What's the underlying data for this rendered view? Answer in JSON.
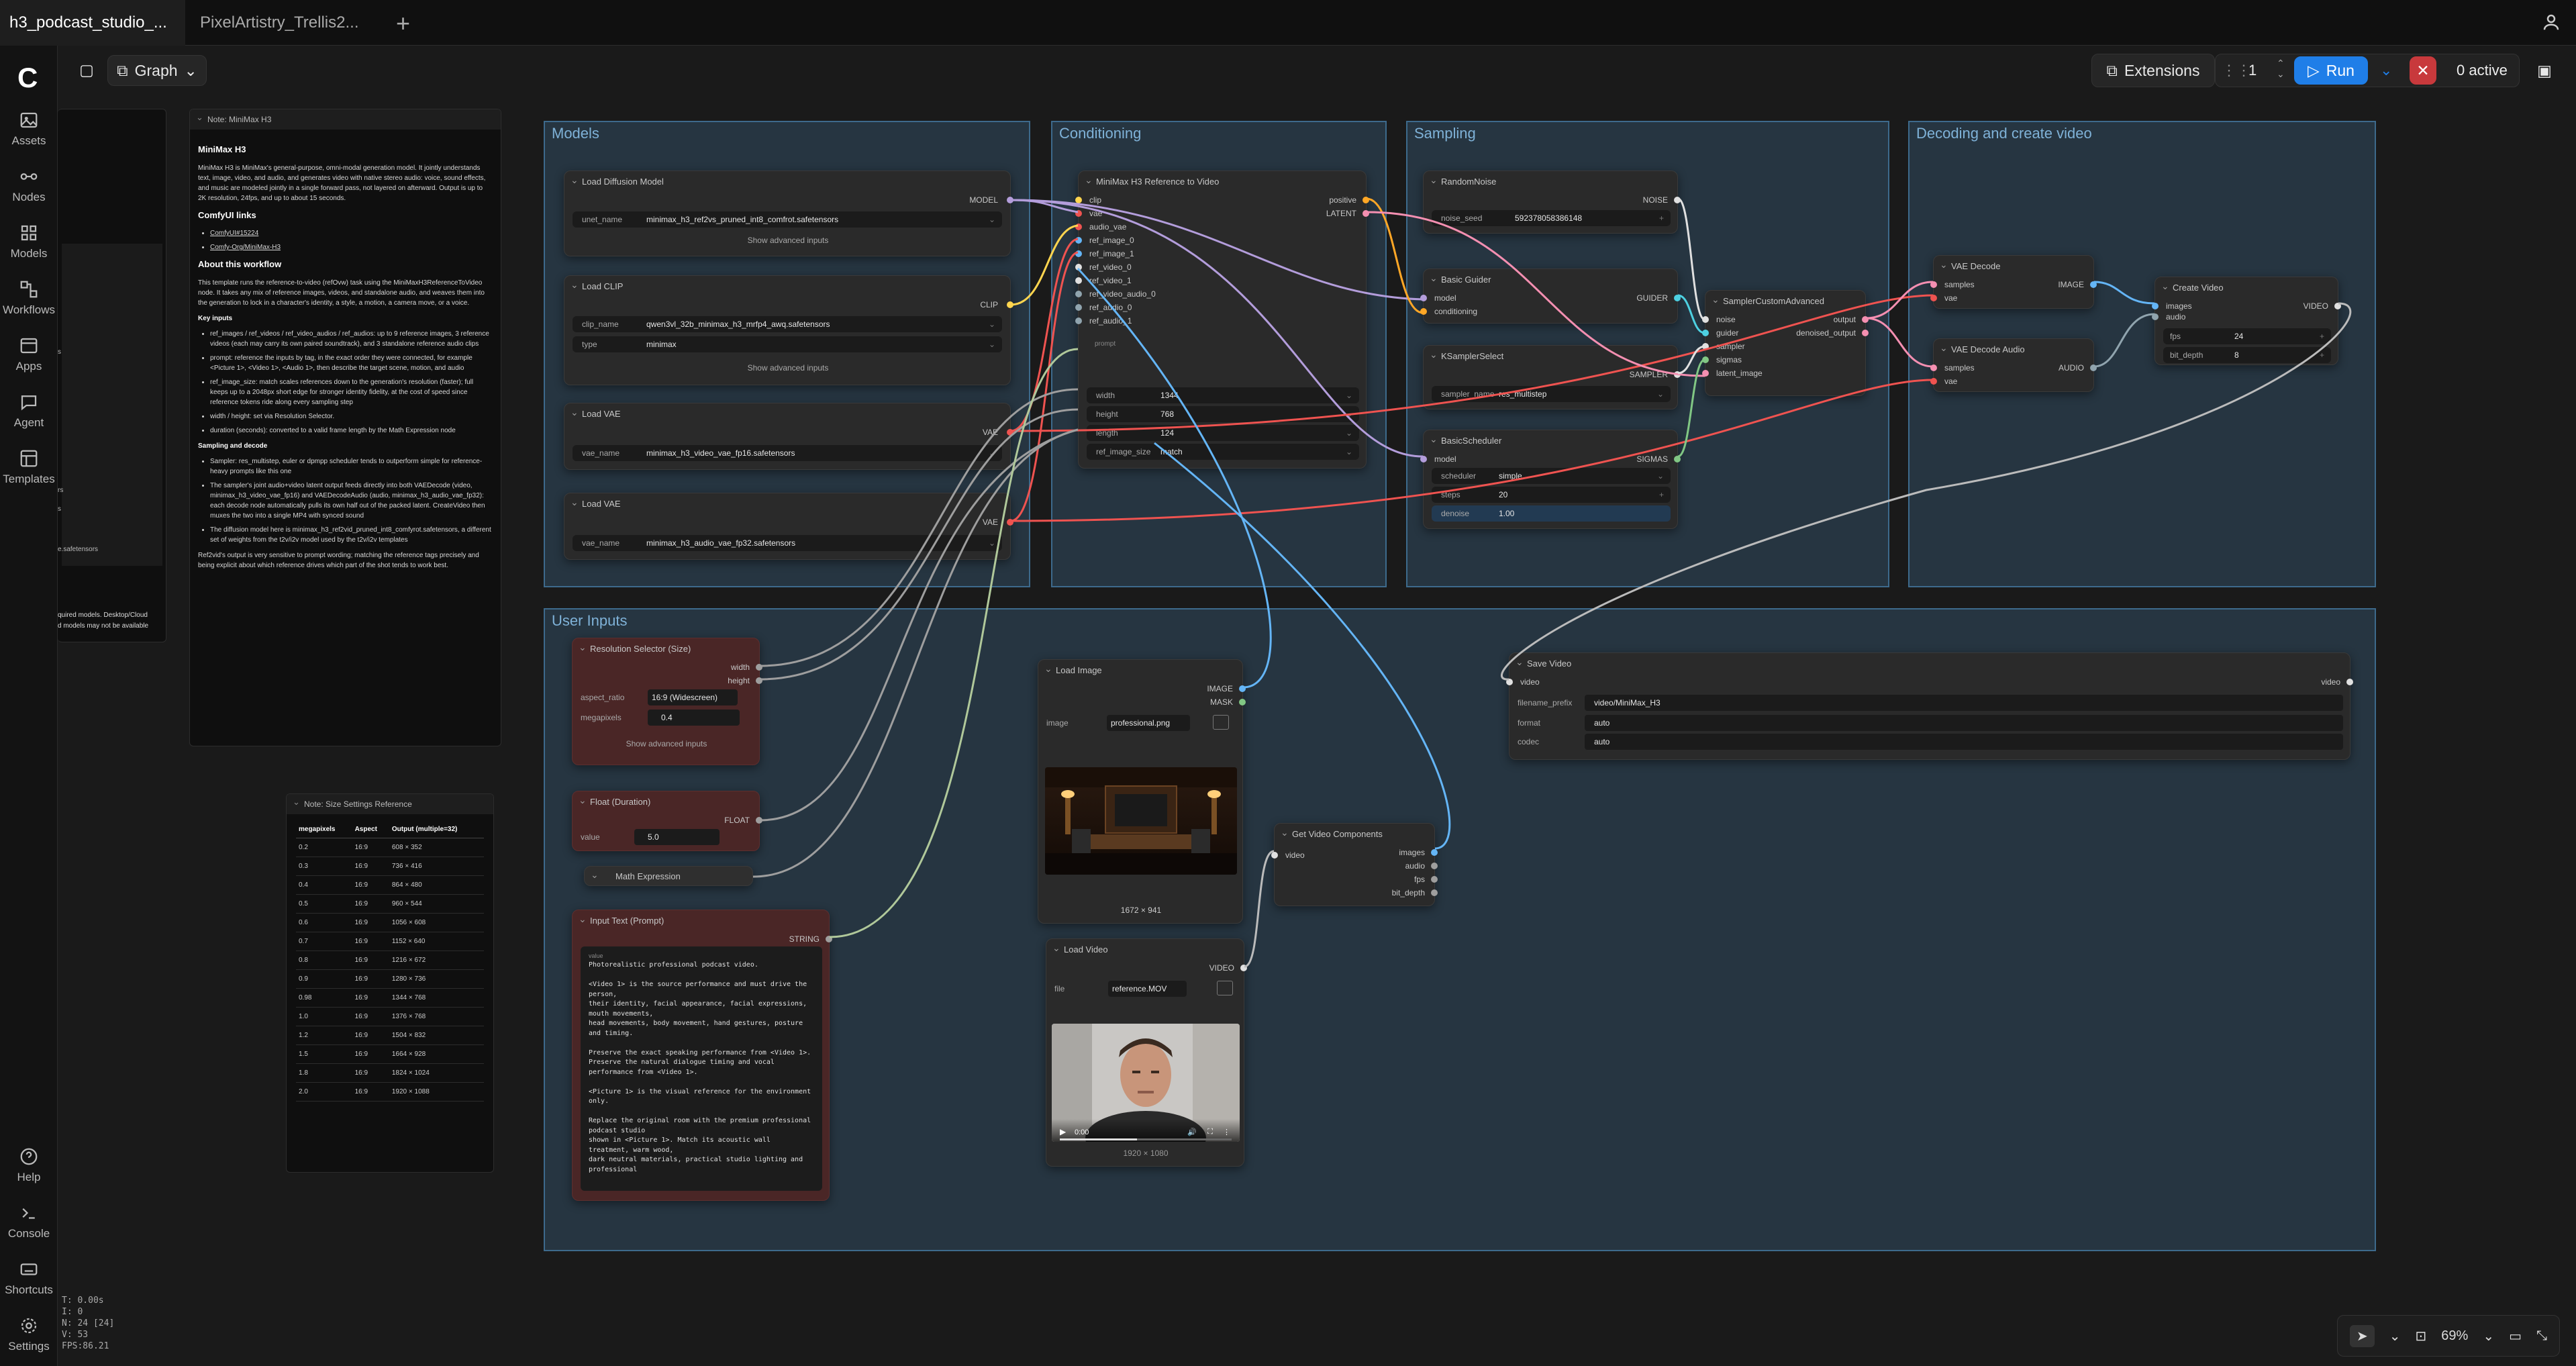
{
  "tabs": [
    {
      "label": "h3_podcast_studio_...",
      "active": true
    },
    {
      "label": "PixelArtistry_Trellis2...",
      "active": false
    }
  ],
  "toolbar": {
    "graph_label": "Graph",
    "extensions_label": "Extensions",
    "queue_count": "1",
    "run_label": "Run",
    "active_label": "0 active"
  },
  "sidebar": {
    "items": [
      {
        "label": "Assets",
        "icon": "image-icon"
      },
      {
        "label": "Nodes",
        "icon": "nodes-icon"
      },
      {
        "label": "Models",
        "icon": "models-icon"
      },
      {
        "label": "Workflows",
        "icon": "workflows-icon"
      },
      {
        "label": "Apps",
        "icon": "apps-icon"
      },
      {
        "label": "Agent",
        "icon": "agent-icon"
      },
      {
        "label": "Templates",
        "icon": "templates-icon"
      }
    ],
    "bottom": [
      {
        "label": "Help"
      },
      {
        "label": "Console"
      },
      {
        "label": "Shortcuts"
      },
      {
        "label": "Settings"
      }
    ]
  },
  "stats": [
    "T: 0.00s",
    "I: 0",
    "N: 24 [24]",
    "V: 53",
    "FPS:86.21"
  ],
  "zoom": "69%",
  "groups": {
    "models": "Models",
    "conditioning": "Conditioning",
    "sampling": "Sampling",
    "decoding": "Decoding and create video",
    "user_inputs": "User Inputs"
  },
  "partial_panel": {
    "lines": [
      "quired models. Desktop/Cloud",
      "d models may not be available"
    ],
    "fragments": [
      "s",
      "rs",
      "s",
      "e.safetensors"
    ]
  },
  "note_minimax": {
    "title": "Note: MiniMax H3",
    "heading": "MiniMax H3",
    "intro": "MiniMax H3 is MiniMax's general-purpose, omni-modal generation model. It jointly understands text, image, video, and audio, and generates video with native stereo audio: voice, sound effects, and music are modeled jointly in a single forward pass, not layered on afterward. Output is up to 2K resolution, 24fps, and up to about 15 seconds.",
    "links_heading": "ComfyUI links",
    "links": [
      "ComfyUI#15224",
      "Comfy-Org/MiniMax-H3"
    ],
    "about_heading": "About this workflow",
    "about": "This template runs the reference-to-video (refOvw) task using the MiniMaxH3ReferenceToVideo node. It takes any mix of reference images, videos, and standalone audio, and weaves them into the generation to lock in a character's identity, a style, a motion, a camera move, or a voice.",
    "key_inputs": "Key inputs",
    "bullets": [
      "ref_images / ref_videos / ref_video_audios / ref_audios: up to 9 reference images, 3 reference videos (each may carry its own paired soundtrack), and 3 standalone reference audio clips",
      "prompt: reference the inputs by tag, in the exact order they were connected, for example <Picture 1>, <Video 1>, <Audio 1>, then describe the target scene, motion, and audio",
      "ref_image_size: match scales references down to the generation's resolution (faster); full keeps up to a 2048px short edge for stronger identity fidelity, at the cost of speed since reference tokens ride along every sampling step",
      "width / height: set via Resolution Selector.",
      "duration (seconds): converted to a valid frame length by the Math Expression node"
    ],
    "sampling_heading": "Sampling and decode",
    "sampling_bullets": [
      "Sampler: res_multistep, euler or dpmpp scheduler tends to outperform simple for reference-heavy prompts like this one",
      "The sampler's joint audio+video latent output feeds directly into both VAEDecode (video, minimax_h3_video_vae_fp16) and VAEDecodeAudio (audio, minimax_h3_audio_vae_fp32): each decode node automatically pulls its own half out of the packed latent. CreateVideo then muxes the two into a single MP4 with synced sound",
      "The diffusion model here is minimax_h3_ref2vid_pruned_int8_comfyrot.safetensors, a different set of weights from the t2v/i2v model used by the t2v/i2v templates"
    ],
    "footer": "Ref2vid's output is very sensitive to prompt wording; matching the reference tags precisely and being explicit about which reference drives which part of the shot tends to work best."
  },
  "note_size": {
    "title": "Note: Size Settings Reference",
    "headers": [
      "megapixels",
      "Aspect",
      "Output (multiple=32)"
    ],
    "rows": [
      [
        "0.2",
        "16:9",
        "608 × 352"
      ],
      [
        "0.3",
        "16:9",
        "736 × 416"
      ],
      [
        "0.4",
        "16:9",
        "864 × 480"
      ],
      [
        "0.5",
        "16:9",
        "960 × 544"
      ],
      [
        "0.6",
        "16:9",
        "1056 × 608"
      ],
      [
        "0.7",
        "16:9",
        "1152 × 640"
      ],
      [
        "0.8",
        "16:9",
        "1216 × 672"
      ],
      [
        "0.9",
        "16:9",
        "1280 × 736"
      ],
      [
        "0.98",
        "16:9",
        "1344 × 768"
      ],
      [
        "1.0",
        "16:9",
        "1376 × 768"
      ],
      [
        "1.2",
        "16:9",
        "1504 × 832"
      ],
      [
        "1.5",
        "16:9",
        "1664 × 928"
      ],
      [
        "1.8",
        "16:9",
        "1824 × 1024"
      ],
      [
        "2.0",
        "16:9",
        "1920 × 1088"
      ]
    ]
  },
  "nodes": {
    "load_diffusion": {
      "title": "Load Diffusion Model",
      "out": "MODEL",
      "w_label": "unet_name",
      "w_value": "minimax_h3_ref2vs_pruned_int8_comfrot.safetensors",
      "adv": "Show advanced inputs"
    },
    "load_clip": {
      "title": "Load CLIP",
      "out": "CLIP",
      "w1_label": "clip_name",
      "w1_value": "qwen3vl_32b_minimax_h3_mrfp4_awq.safetensors",
      "w2_label": "type",
      "w2_value": "minimax",
      "adv": "Show advanced inputs"
    },
    "load_vae1": {
      "title": "Load VAE",
      "out": "VAE",
      "w_label": "vae_name",
      "w_value": "minimax_h3_video_vae_fp16.safetensors"
    },
    "load_vae2": {
      "title": "Load VAE",
      "out": "VAE",
      "w_label": "vae_name",
      "w_value": "minimax_h3_audio_vae_fp32.safetensors"
    },
    "ref_video": {
      "title": "MiniMax H3 Reference to Video",
      "inputs": [
        "clip",
        "vae",
        "audio_vae",
        "ref_image_0",
        "ref_image_1",
        "ref_video_0",
        "ref_video_1",
        "ref_video_audio_0",
        "ref_audio_0",
        "ref_audio_1"
      ],
      "outputs": [
        "positive",
        "LATENT"
      ],
      "prompt": "prompt",
      "widgets": [
        {
          "label": "width",
          "value": "1344"
        },
        {
          "label": "height",
          "value": "768"
        },
        {
          "label": "length",
          "value": "124"
        },
        {
          "label": "ref_image_size",
          "value": "match"
        }
      ]
    },
    "random_noise": {
      "title": "RandomNoise",
      "out": "NOISE",
      "w_label": "noise_seed",
      "w_value": "592378058386148"
    },
    "basic_guider": {
      "title": "Basic Guider",
      "in": [
        "model",
        "conditioning"
      ],
      "out": "GUIDER"
    },
    "ksampler_select": {
      "title": "KSamplerSelect",
      "out": "SAMPLER",
      "w_label": "sampler_name",
      "w_value": "res_multistep"
    },
    "basic_scheduler": {
      "title": "BasicScheduler",
      "in": [
        "model"
      ],
      "out": "SIGMAS",
      "widgets": [
        {
          "label": "scheduler",
          "value": "simple"
        },
        {
          "label": "steps",
          "value": "20"
        },
        {
          "label": "denoise",
          "value": "1.00"
        }
      ]
    },
    "sampler_custom": {
      "title": "SamplerCustomAdvanced",
      "in": [
        "noise",
        "guider",
        "sampler",
        "sigmas",
        "latent_image"
      ],
      "out": [
        "output",
        "denoised_output"
      ]
    },
    "vae_decode": {
      "title": "VAE Decode",
      "in": [
        "samples",
        "vae"
      ],
      "out": "IMAGE"
    },
    "vae_decode_audio": {
      "title": "VAE Decode Audio",
      "in": [
        "samples",
        "vae"
      ],
      "out": "AUDIO"
    },
    "create_video": {
      "title": "Create Video",
      "in": [
        "images",
        "audio"
      ],
      "out": "VIDEO",
      "widgets": [
        {
          "label": "fps",
          "value": "24"
        },
        {
          "label": "bit_depth",
          "value": "8"
        }
      ]
    },
    "save_video": {
      "title": "Save Video",
      "in": "video",
      "out": "video",
      "widgets": [
        {
          "label": "filename_prefix",
          "value": "video/MiniMax_H3"
        },
        {
          "label": "format",
          "value": "auto"
        },
        {
          "label": "codec",
          "value": "auto"
        }
      ]
    },
    "resolution": {
      "title": "Resolution Selector (Size)",
      "outs": [
        "width",
        "height"
      ],
      "widgets": [
        {
          "label": "aspect_ratio",
          "value": "16:9 (Widescreen)"
        },
        {
          "label": "megapixels",
          "value": "0.4"
        }
      ],
      "adv": "Show advanced inputs"
    },
    "float_duration": {
      "title": "Float (Duration)",
      "out": "FLOAT",
      "w_label": "value",
      "w_value": "5.0"
    },
    "math_expr": {
      "title": "Math Expression"
    },
    "input_text": {
      "title": "Input Text (Prompt)",
      "out": "STRING",
      "label": "value",
      "text": "Photorealistic professional podcast video.\n\n<Video 1> is the source performance and must drive the person,\ntheir identity, facial appearance, facial expressions, mouth movements,\nhead movements, body movement, hand gestures, posture and timing.\n\nPreserve the exact speaking performance from <Video 1>.\nPreserve the natural dialogue timing and vocal performance from <Video 1>.\n\n<Picture 1> is the visual reference for the environment only.\n\nReplace the original room with the premium professional podcast studio\nshown in <Picture 1>. Match its acoustic wall treatment, warm wood,\ndark neutral materials, practical studio lighting and professional"
    },
    "load_image": {
      "title": "Load Image",
      "outs": [
        "IMAGE",
        "MASK"
      ],
      "w_label": "image",
      "w_value": "professional.png",
      "dims": "1672 × 941"
    },
    "get_video": {
      "title": "Get Video Components",
      "in": "video",
      "outs": [
        "images",
        "audio",
        "fps",
        "bit_depth"
      ]
    },
    "load_video": {
      "title": "Load Video",
      "out": "VIDEO",
      "w_label": "file",
      "w_value": "reference.MOV",
      "time": "0:00",
      "dims": "1920 × 1080"
    }
  }
}
